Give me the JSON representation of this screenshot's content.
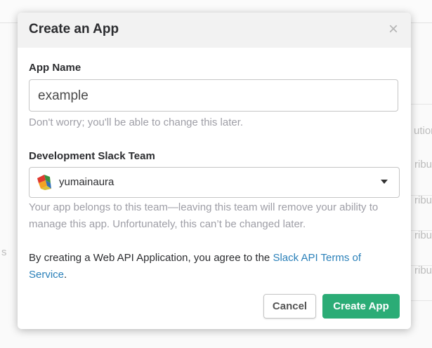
{
  "background": {
    "right_fragments": [
      "ution",
      "ribu",
      "ribu",
      "ribu",
      "ribu"
    ],
    "left_fragment": "s"
  },
  "modal": {
    "title": "Create an App",
    "close_icon": "close-icon"
  },
  "app_name": {
    "label": "App Name",
    "value": "example",
    "help": "Don't worry; you'll be able to change this later."
  },
  "team": {
    "label": "Development Slack Team",
    "selected": "yumainaura",
    "help": "Your app belongs to this team—leaving this team will remove your ability to manage this app. Unfortunately, this can’t be changed later."
  },
  "terms": {
    "text": "By creating a Web API Application, you agree to the ",
    "link": "Slack API Terms of Service",
    "end": "."
  },
  "buttons": {
    "cancel": "Cancel",
    "create": "Create App"
  },
  "colors": {
    "create_button": "#2bac76",
    "link": "#2a80b9"
  }
}
